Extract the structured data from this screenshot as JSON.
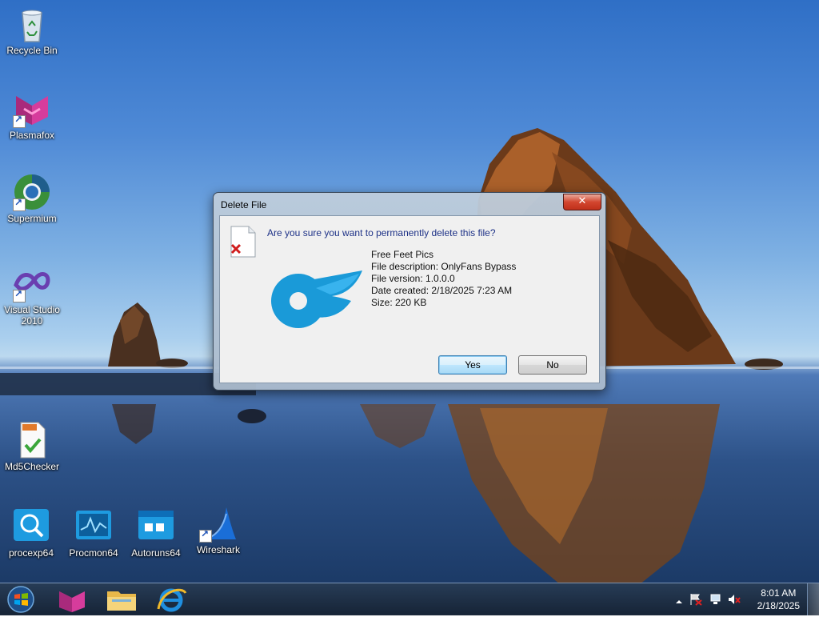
{
  "desktop": {
    "icons": [
      {
        "label": "Recycle Bin",
        "icon": "recycle-bin-icon"
      },
      {
        "label": "Plasmafox",
        "icon": "plasmafox-icon"
      },
      {
        "label": "Supermium",
        "icon": "supermium-icon"
      },
      {
        "label": "Visual Studio\n2010",
        "icon": "visual-studio-icon"
      },
      {
        "label": "Md5Checker",
        "icon": "md5checker-icon"
      },
      {
        "label": "procexp64",
        "icon": "procexp-icon"
      },
      {
        "label": "Procmon64",
        "icon": "procmon-icon"
      },
      {
        "label": "Autoruns64",
        "icon": "autoruns-icon"
      },
      {
        "label": "Wireshark",
        "icon": "wireshark-icon"
      }
    ]
  },
  "dialog": {
    "title": "Delete File",
    "close_label": "✕",
    "question": "Are you sure you want to permanently delete this file?",
    "file": {
      "name": "Free Feet Pics",
      "description": "File description: OnlyFans Bypass",
      "version": "File version: 1.0.0.0",
      "created": "Date created: 2/18/2025 7:23 AM",
      "size": "Size: 220 KB"
    },
    "buttons": {
      "yes": "Yes",
      "no": "No"
    },
    "colors": {
      "thumb_blue": "#1a9ad8"
    }
  },
  "taskbar": {
    "apps": [
      "start-orb-icon",
      "plasmafox-icon",
      "file-explorer-icon",
      "internet-explorer-icon"
    ],
    "clock": {
      "time": "8:01 AM",
      "date": "2/18/2025"
    }
  }
}
